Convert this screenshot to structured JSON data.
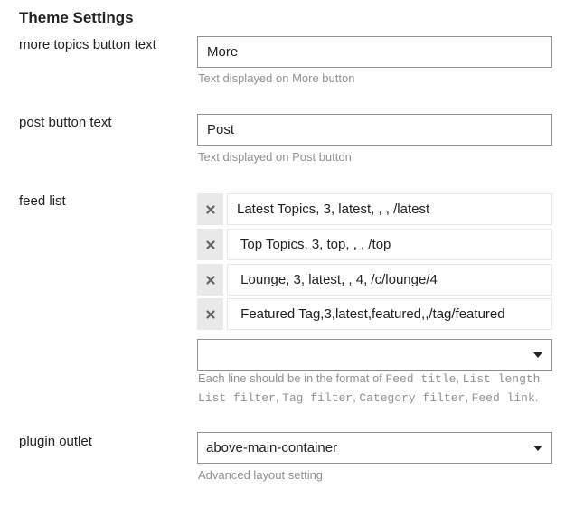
{
  "page": {
    "title": "Theme Settings"
  },
  "settings": {
    "more_topics": {
      "label": "more topics button text",
      "value": "More",
      "help": "Text displayed on More button"
    },
    "post_button": {
      "label": "post button text",
      "value": "Post",
      "help": "Text displayed on Post button"
    },
    "feed_list": {
      "label": "feed list",
      "items": [
        "Latest Topics, 3, latest, , , /latest",
        " Top Topics, 3, top, , , /top",
        " Lounge, 3, latest, , 4, /c/lounge/4",
        " Featured Tag,3,latest,featured,,/tag/featured"
      ],
      "new_item_value": "",
      "help": {
        "prefix": "Each line should be in the format of ",
        "feed_title": "Feed title",
        "list_length": "List length",
        "list_filter": "List filter",
        "tag_filter": "Tag filter",
        "category_filter": "Category filter",
        "feed_link": "Feed link",
        "sep": ", ",
        "end": "."
      }
    },
    "plugin_outlet": {
      "label": "plugin outlet",
      "value": "above-main-container",
      "help": "Advanced layout setting"
    }
  },
  "icons": {
    "remove": "close-icon",
    "dropdown": "caret-down-icon"
  }
}
